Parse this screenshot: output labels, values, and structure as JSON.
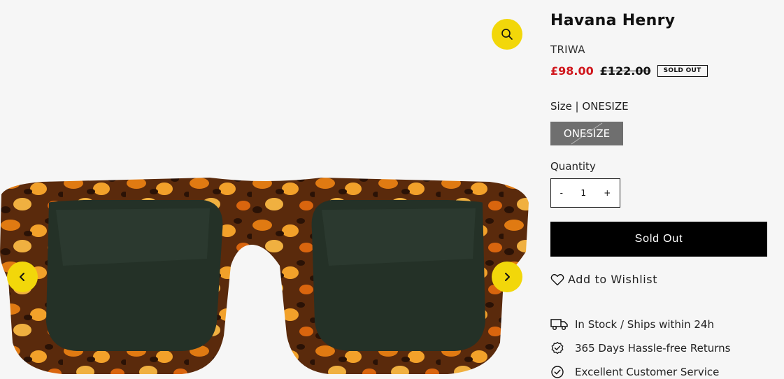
{
  "product": {
    "title": "Havana Henry",
    "vendor": "TRIWA",
    "sale_price": "£98.00",
    "compare_price": "£122.00",
    "badge": "SOLD OUT"
  },
  "size": {
    "label": "Size | ONESIZE",
    "option": "ONESIZE"
  },
  "quantity": {
    "label": "Quantity",
    "minus": "-",
    "value": "1",
    "plus": "+"
  },
  "buttons": {
    "sold_out": "Sold Out",
    "wishlist": "Add to Wishlist"
  },
  "features": [
    {
      "icon": "truck-icon",
      "text": "In Stock / Ships within 24h"
    },
    {
      "icon": "badge-check-icon",
      "text": "365 Days Hassle-free Returns"
    },
    {
      "icon": "check-circle-icon",
      "text": "Excellent Customer Service"
    }
  ],
  "gallery": {
    "image": "tortoiseshell-sunglasses",
    "icons": [
      "search-icon",
      "chevron-left-icon",
      "chevron-right-icon"
    ]
  },
  "colors": {
    "accent_yellow": "#f2d70a",
    "sale_red": "#d0161c",
    "button_black": "#000000",
    "swatch_grey": "#6f6f6f"
  }
}
